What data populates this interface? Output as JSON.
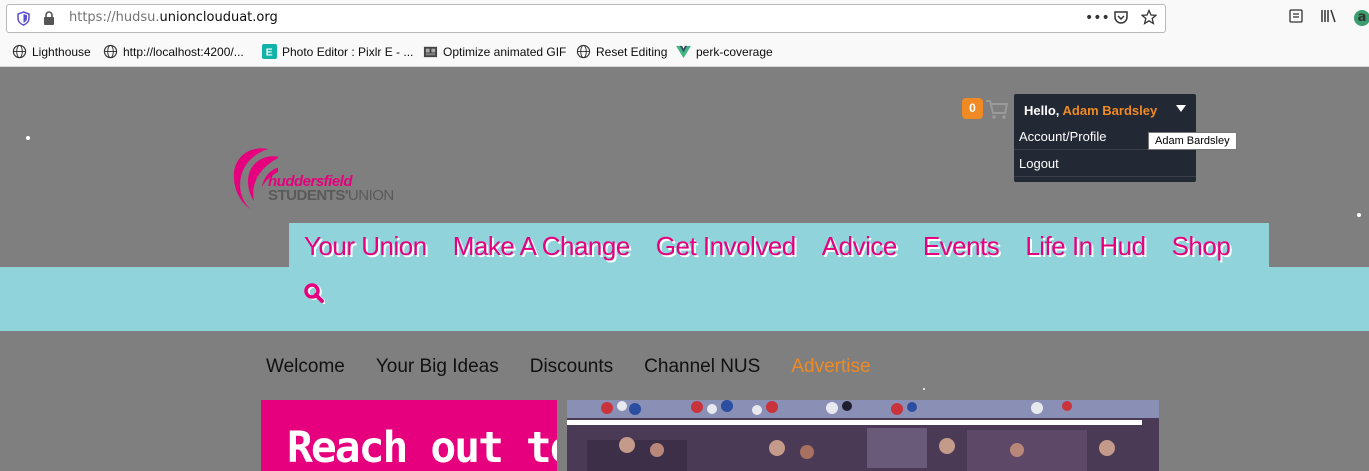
{
  "browser": {
    "url_prefix": "https://hudsu.",
    "url_host": "unionclouduat.org",
    "bookmarks": [
      {
        "label": "Lighthouse",
        "icon": "globe-icon"
      },
      {
        "label": "http://localhost:4200/...",
        "icon": "globe-icon"
      },
      {
        "label": "Photo Editor : Pixlr E - ...",
        "icon": "pixlr-icon"
      },
      {
        "label": "Optimize animated GIF",
        "icon": "gif-icon"
      },
      {
        "label": "Reset Editing",
        "icon": "globe-icon"
      },
      {
        "label": "perk-coverage",
        "icon": "vue-icon"
      }
    ]
  },
  "header": {
    "cart_count": "0",
    "hello_label": "Hello,",
    "user_name": "Adam Bardsley",
    "menu_items": [
      "Account/Profile",
      "Logout"
    ],
    "tooltip": "Adam Bardsley"
  },
  "logo": {
    "line1": "huddersfield",
    "line2_bold": "STUDENTS'",
    "line2_light": "UNION"
  },
  "nav": {
    "items": [
      "Your Union",
      "Make A Change",
      "Get Involved",
      "Advice",
      "Events",
      "Life In Hud",
      "Shop"
    ]
  },
  "subnav": {
    "items": [
      "Welcome",
      "Your Big Ideas",
      "Discounts",
      "Channel NUS",
      "Advertise"
    ],
    "active": "Advertise"
  },
  "promo": {
    "text": "Reach out to"
  },
  "colors": {
    "brand_pink": "#e6007e",
    "accent_orange": "#f08a24",
    "nav_teal": "#91d3db",
    "page_gray": "#7f7f7f",
    "menu_dark": "#222834"
  }
}
